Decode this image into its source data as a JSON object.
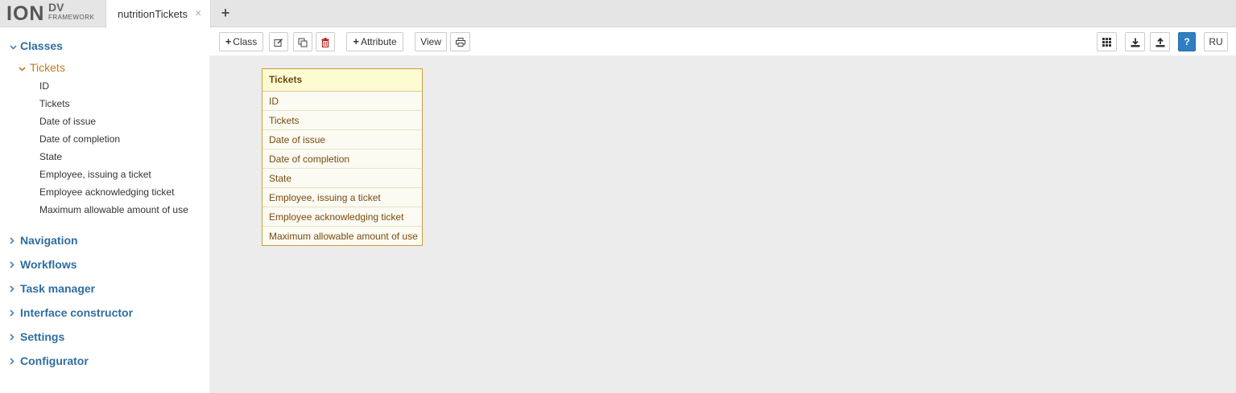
{
  "app": {
    "logo_main": "ION",
    "logo_sup": "DV",
    "logo_sub": "FRAMEWORK",
    "tab_label": "nutritionTickets",
    "tab_close": "×",
    "tab_add": "+"
  },
  "sidebar": {
    "chevron_down": "⌄",
    "chevron_right": "›",
    "classes_label": "Classes",
    "tickets_label": "Tickets",
    "attributes": [
      "ID",
      "Tickets",
      "Date of issue",
      "Date of completion",
      "State",
      "Employee, issuing a ticket",
      "Employee acknowledging ticket",
      "Maximum allowable amount of use"
    ],
    "sections": [
      "Navigation",
      "Workflows",
      "Task manager",
      "Interface constructor",
      "Settings",
      "Configurator"
    ]
  },
  "toolbar": {
    "plus": "+",
    "class_label": "Class",
    "attribute_label": "Attribute",
    "view_label": "View",
    "help_label": "?",
    "lang_label": "RU"
  },
  "diagram": {
    "class_title": "Tickets",
    "rows": [
      "ID",
      "Tickets",
      "Date of issue",
      "Date of completion",
      "State",
      "Employee, issuing a ticket",
      "Employee acknowledging ticket",
      "Maximum allowable amount of use"
    ]
  },
  "colors": {
    "section_blue": "#2e6ea3",
    "active_orange": "#c17a1e",
    "help_blue": "#2f7ec1",
    "class_border": "#c9a13b"
  }
}
